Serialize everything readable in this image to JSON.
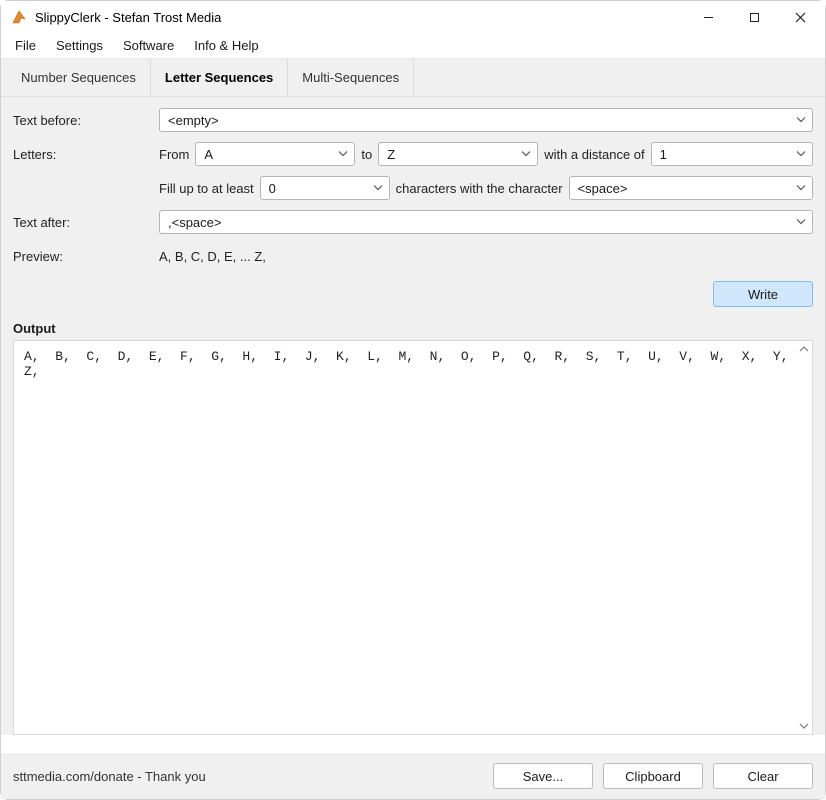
{
  "window": {
    "title": "SlippyClerk - Stefan Trost Media"
  },
  "menu": {
    "file": "File",
    "settings": "Settings",
    "software": "Software",
    "info_help": "Info & Help"
  },
  "tabs": {
    "number": "Number Sequences",
    "letter": "Letter Sequences",
    "multi": "Multi-Sequences"
  },
  "labels": {
    "text_before": "Text before:",
    "letters": "Letters:",
    "from": "From",
    "to": "to",
    "distance": "with a distance of",
    "fill_up": "Fill up to at least",
    "chars_with": "characters with the character",
    "text_after": "Text after:",
    "preview": "Preview:",
    "output": "Output"
  },
  "values": {
    "text_before": "<empty>",
    "from_letter": "A",
    "to_letter": "Z",
    "distance": "1",
    "fill_count": "0",
    "fill_char": "<space>",
    "text_after": ",<space>",
    "preview": "A, B, C, D, E, ... Z,",
    "output": "A,  B,  C,  D,  E,  F,  G,  H,  I,  J,  K,  L,  M,  N,  O,  P,  Q,  R,  S,  T,  U,  V,  W,  X,  Y,  Z,  "
  },
  "buttons": {
    "write": "Write",
    "save": "Save...",
    "clipboard": "Clipboard",
    "clear": "Clear"
  },
  "status": "sttmedia.com/donate - Thank you"
}
